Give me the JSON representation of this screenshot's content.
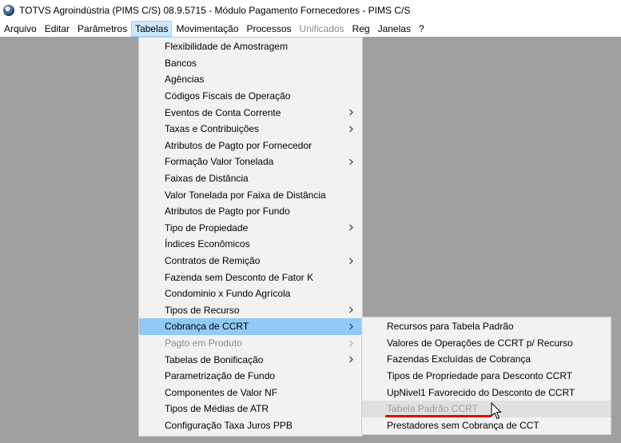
{
  "window": {
    "title": "TOTVS Agroindústria (PIMS C/S) 08.9.5715 - Módulo Pagamento Fornecedores - PIMS C/S"
  },
  "menubar": [
    {
      "label": "Arquivo",
      "state": "normal"
    },
    {
      "label": "Editar",
      "state": "normal"
    },
    {
      "label": "Parâmetros",
      "state": "normal"
    },
    {
      "label": "Tabelas",
      "state": "active"
    },
    {
      "label": "Movimentação",
      "state": "normal"
    },
    {
      "label": "Processos",
      "state": "normal"
    },
    {
      "label": "Unificados",
      "state": "disabled"
    },
    {
      "label": "Reg",
      "state": "normal"
    },
    {
      "label": "Janelas",
      "state": "normal"
    },
    {
      "label": "?",
      "state": "normal"
    }
  ],
  "tabelas_menu": [
    {
      "label": "Flexibilidade de Amostragem",
      "submenu": false
    },
    {
      "label": "Bancos",
      "submenu": false
    },
    {
      "label": "Agências",
      "submenu": false
    },
    {
      "label": "Códigos Fiscais de Operação",
      "submenu": false
    },
    {
      "label": "Eventos de Conta Corrente",
      "submenu": true
    },
    {
      "label": "Taxas e Contribuições",
      "submenu": true
    },
    {
      "label": "Atributos de Pagto por Fornecedor",
      "submenu": false
    },
    {
      "label": "Formação Valor Tonelada",
      "submenu": true
    },
    {
      "label": "Faixas de Distância",
      "submenu": false
    },
    {
      "label": "Valor Tonelada por Faixa de Distância",
      "submenu": false
    },
    {
      "label": "Atributos de Pagto por Fundo",
      "submenu": false
    },
    {
      "label": "Tipo de Propiedade",
      "submenu": true
    },
    {
      "label": "Índices Econômicos",
      "submenu": false
    },
    {
      "label": "Contratos de Remição",
      "submenu": true
    },
    {
      "label": "Fazenda sem Desconto de Fator K",
      "submenu": false
    },
    {
      "label": "Condominio x Fundo Agrícola",
      "submenu": false
    },
    {
      "label": "Tipos de Recurso",
      "submenu": true
    },
    {
      "label": "Cobrança de CCRT",
      "submenu": true,
      "state": "highlight"
    },
    {
      "label": "Pagto em Produto",
      "submenu": true,
      "state": "disabled"
    },
    {
      "label": "Tabelas de Bonificação",
      "submenu": true
    },
    {
      "label": "Parametrização de Fundo",
      "submenu": false
    },
    {
      "label": "Componentes de Valor NF",
      "submenu": false
    },
    {
      "label": "Tipos de Médias de ATR",
      "submenu": false
    },
    {
      "label": "Configuração Taxa Juros PPB",
      "submenu": false
    }
  ],
  "ccrt_submenu": [
    {
      "label": "Recursos para Tabela Padrão"
    },
    {
      "label": "Valores de Operações de CCRT p/ Recurso"
    },
    {
      "label": "Fazendas Excluídas de Cobrança"
    },
    {
      "label": "Tipos de Propriedade para Desconto CCRT"
    },
    {
      "label": "UpNivel1 Favorecido do Desconto de CCRT"
    },
    {
      "label": "Tabela Padrão CCRT",
      "state": "hovered"
    },
    {
      "label": "Prestadores sem Cobrança de CCT"
    }
  ],
  "icons": {
    "submenu_arrow": "chevron-right-icon",
    "app": "totvs-logo-icon",
    "pointer": "mouse-cursor-icon"
  },
  "colors": {
    "highlight": "#91c9f7",
    "active_menu": "#cce8ff",
    "annotation": "#e8000b",
    "desktop": "#a0a0a0"
  }
}
